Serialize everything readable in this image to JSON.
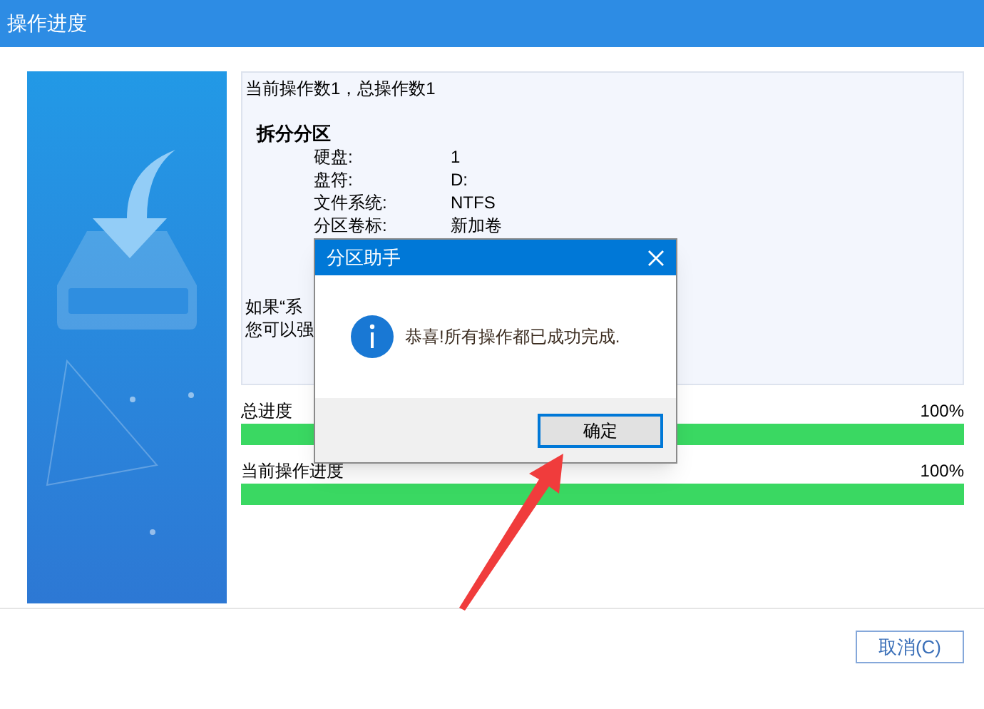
{
  "window": {
    "title": "操作进度"
  },
  "summary": "当前操作数1，总操作数1",
  "operation": {
    "name": "拆分分区",
    "fields": [
      {
        "label": "硬盘:",
        "value": "1"
      },
      {
        "label": "盘符:",
        "value": "D:"
      },
      {
        "label": "文件系统:",
        "value": "NTFS"
      },
      {
        "label": "分区卷标:",
        "value": "新加卷"
      }
    ]
  },
  "note_lines": [
    "如果“系",
    "您可以强"
  ],
  "progress": [
    {
      "label": "总进度",
      "reading": "100%",
      "level": 1
    },
    {
      "label": "当前操作进度",
      "reading": "100%",
      "level": 1
    }
  ],
  "cancel_button": "取消(C)",
  "dialog": {
    "title": "分区助手",
    "message": "恭喜!所有操作都已成功完成.",
    "ok_button": "确定"
  }
}
